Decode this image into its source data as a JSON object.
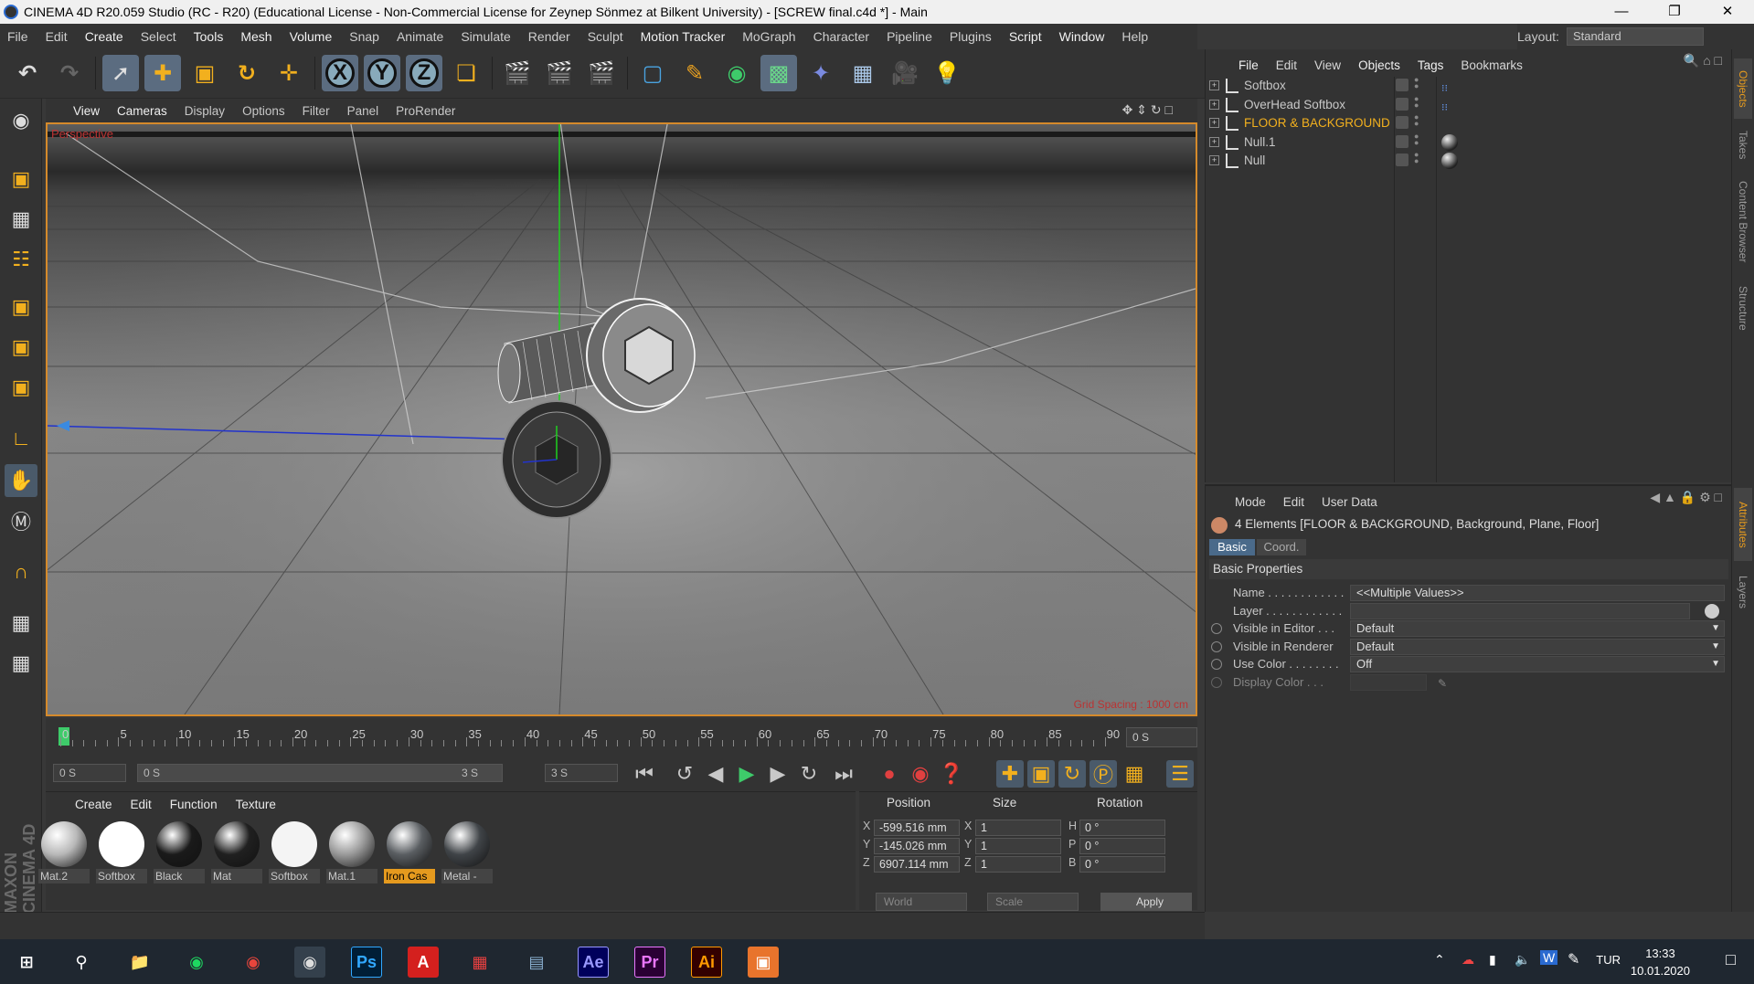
{
  "window": {
    "title": "CINEMA 4D R20.059 Studio (RC - R20) (Educational License - Non-Commercial License for Zeynep  Sönmez at Bilkent University) - [SCREW final.c4d *] - Main"
  },
  "menubar": {
    "items": [
      "File",
      "Edit",
      "Create",
      "Select",
      "Tools",
      "Mesh",
      "Volume",
      "Snap",
      "Animate",
      "Simulate",
      "Render",
      "Sculpt",
      "Motion Tracker",
      "MoGraph",
      "Character",
      "Pipeline",
      "Plugins",
      "Script",
      "Window",
      "Help"
    ]
  },
  "layout": {
    "label": "Layout:",
    "value": "Standard"
  },
  "viewport": {
    "menu": [
      "View",
      "Cameras",
      "Display",
      "Options",
      "Filter",
      "Panel",
      "ProRender"
    ],
    "camera_label": "Perspective",
    "grid_spacing": "Grid Spacing : 1000 cm"
  },
  "timeline": {
    "ticks": [
      "0",
      "5",
      "10",
      "15",
      "20",
      "25",
      "30",
      "35",
      "40",
      "45",
      "50",
      "55",
      "60",
      "65",
      "70",
      "75",
      "80",
      "85",
      "90"
    ],
    "current_frame": "0 S",
    "start": "0 S",
    "range_start": "0 S",
    "range_end": "3 S",
    "end": "3 S"
  },
  "materials": {
    "menu": [
      "Create",
      "Edit",
      "Function",
      "Texture"
    ],
    "items": [
      {
        "name": "Mat.2",
        "color": "#b8b8b8",
        "selected": false
      },
      {
        "name": "Softbox",
        "color": "#ffffff",
        "selected": false
      },
      {
        "name": "Black",
        "color": "#1a1a1a",
        "selected": false
      },
      {
        "name": "Mat",
        "color": "#202020",
        "selected": false
      },
      {
        "name": "Softbox",
        "color": "#f4f4f4",
        "selected": false
      },
      {
        "name": "Mat.1",
        "color": "#9a9a9a",
        "selected": false
      },
      {
        "name": "Iron Cas",
        "color": "#5a5e62",
        "selected": true
      },
      {
        "name": "Metal -",
        "color": "#404448",
        "selected": false
      }
    ]
  },
  "coords": {
    "headers": {
      "position": "Position",
      "size": "Size",
      "rotation": "Rotation"
    },
    "rows": [
      {
        "axis": "X",
        "position": "-599.516 mm",
        "size_axis": "X",
        "size": "1",
        "rot_axis": "H",
        "rotation": "0 °"
      },
      {
        "axis": "Y",
        "position": "-145.026 mm",
        "size_axis": "Y",
        "size": "1",
        "rot_axis": "P",
        "rotation": "0 °"
      },
      {
        "axis": "Z",
        "position": "6907.114 mm",
        "size_axis": "Z",
        "size": "1",
        "rot_axis": "B",
        "rotation": "0 °"
      }
    ],
    "space": "World",
    "mode": "Scale",
    "apply": "Apply"
  },
  "objects": {
    "menu": [
      "File",
      "Edit",
      "View",
      "Objects",
      "Tags",
      "Bookmarks"
    ],
    "items": [
      {
        "name": "Softbox",
        "highlight": false,
        "tag": "dots"
      },
      {
        "name": "OverHead Softbox",
        "highlight": false,
        "tag": "dots"
      },
      {
        "name": "FLOOR & BACKGROUND",
        "highlight": true,
        "tag": ""
      },
      {
        "name": "Null.1",
        "highlight": false,
        "tag": "sphere"
      },
      {
        "name": "Null",
        "highlight": false,
        "tag": "sphere"
      }
    ]
  },
  "attributes": {
    "menu": [
      "Mode",
      "Edit",
      "User Data"
    ],
    "summary": "4 Elements [FLOOR & BACKGROUND, Background, Plane, Floor]",
    "tabs": [
      "Basic",
      "Coord."
    ],
    "section": "Basic Properties",
    "rows": [
      {
        "label": "Name . . . . . . . . . . . .",
        "value": "<<Multiple Values>>"
      },
      {
        "label": "Layer . . . . . . . . . . . .",
        "value": ""
      },
      {
        "label": "Visible in Editor . . .",
        "value": "Default"
      },
      {
        "label": "Visible in Renderer",
        "value": "Default"
      },
      {
        "label": "Use Color . . . . . . . .",
        "value": "Off"
      },
      {
        "label": "Display Color . . .",
        "value": ""
      }
    ]
  },
  "side_tabs": [
    "Objects",
    "Takes",
    "Content Browser",
    "Structure",
    "Attributes",
    "Layers"
  ],
  "brand": "MAXON CINEMA 4D",
  "taskbar": {
    "apps": [
      "windows-start",
      "search",
      "file-explorer",
      "spotify",
      "chrome",
      "cinema4d",
      "photoshop",
      "acrobat",
      "sketchup",
      "cad",
      "after-effects",
      "premiere",
      "illustrator",
      "other"
    ],
    "app_labels": {
      "ps": "Ps",
      "acrobat": "A",
      "ae": "Ae",
      "pr": "Pr",
      "ai": "Ai"
    },
    "language": "TUR",
    "time": "13:33",
    "date": "10.01.2020"
  }
}
